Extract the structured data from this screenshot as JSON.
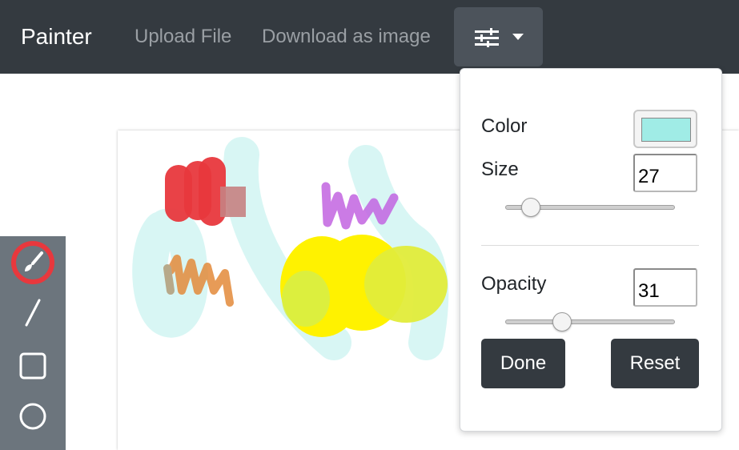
{
  "navbar": {
    "brand": "Painter",
    "links": [
      "Upload File",
      "Download as image"
    ],
    "settings_icon": "sliders-icon",
    "caret_icon": "caret-down-icon"
  },
  "toolbar": {
    "tools": [
      {
        "icon": "brush-icon",
        "active": true
      },
      {
        "icon": "line-icon",
        "active": false
      },
      {
        "icon": "rectangle-icon",
        "active": false
      },
      {
        "icon": "circle-icon",
        "active": false
      }
    ],
    "active_highlight_color": "#e8383d"
  },
  "settings": {
    "color_label": "Color",
    "color_value": "#a0ece6",
    "size_label": "Size",
    "size_value": "27",
    "size_fraction": 0.1,
    "opacity_label": "Opacity",
    "opacity_value": "31",
    "opacity_fraction": 0.31,
    "done_label": "Done",
    "reset_label": "Reset"
  },
  "colors": {
    "navbar_bg": "#343a40",
    "toolbar_bg": "#6c757d",
    "button_bg": "#343a40"
  }
}
